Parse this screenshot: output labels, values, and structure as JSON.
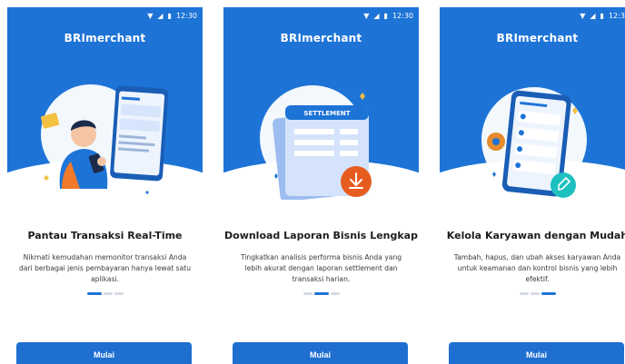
{
  "status": {
    "time": "12:30"
  },
  "screens": [
    {
      "logo": "BRImerchant",
      "title": "Pantau Transaksi Real-Time",
      "description": "Nikmati kemudahan memonitor transaksi Anda dari berbagai jenis pembayaran hanya lewat satu aplikasi.",
      "cta": "Mulai",
      "active_page": 1,
      "page_count": 3,
      "illustration_icon": "person-with-phone-illustration"
    },
    {
      "logo": "BRImerchant",
      "title": "Download Laporan Bisnis Lengkap",
      "description": "Tingkatkan analisis performa bisnis Anda yang lebih akurat dengan laporan settlement dan transaksi harian.",
      "cta": "Mulai",
      "active_page": 2,
      "page_count": 3,
      "illustration_icon": "settlement-document-illustration",
      "illustration_text": "SETTLEMENT"
    },
    {
      "logo": "BRImerchant",
      "title": "Kelola Karyawan dengan Mudah",
      "description": "Tambah, hapus, dan ubah akses karyawan Anda untuk keamanan dan kontrol bisnis yang lebih efektif.",
      "cta": "Mulai",
      "active_page": 3,
      "page_count": 3,
      "illustration_icon": "employee-management-illustration"
    }
  ],
  "colors": {
    "primary": "#1e74d6",
    "button": "#1e6fd0",
    "accent_orange": "#f07a2a",
    "accent_teal": "#1ec0c0"
  }
}
